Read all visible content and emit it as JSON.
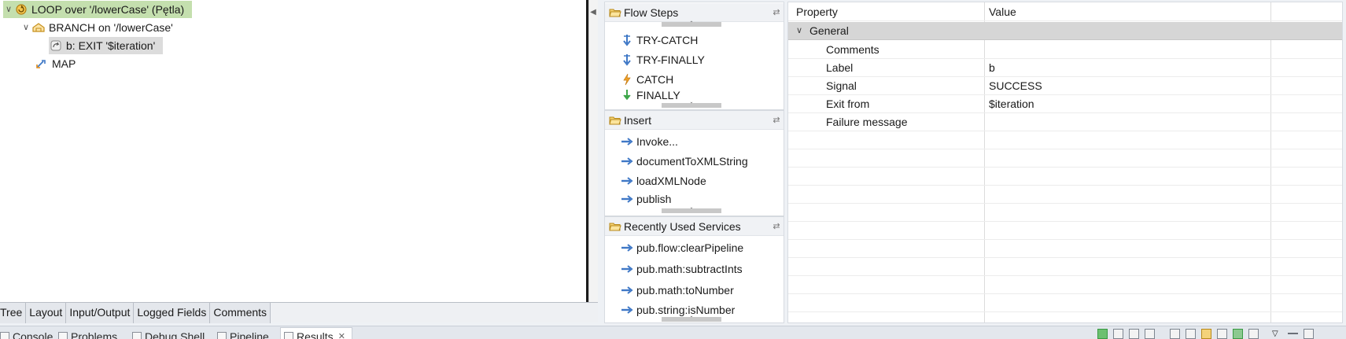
{
  "tree": {
    "nodes": [
      {
        "label": "LOOP over '/lowerCase' (Pętla)",
        "expanded": true,
        "icon": "loop-icon"
      },
      {
        "label": "BRANCH on '/lowerCase'",
        "expanded": true,
        "icon": "branch-icon"
      },
      {
        "label": "b: EXIT '$iteration'",
        "icon": "exit-icon"
      },
      {
        "label": "MAP",
        "icon": "map-icon"
      }
    ],
    "tabs": [
      "Tree",
      "Layout",
      "Input/Output",
      "Logged Fields",
      "Comments"
    ]
  },
  "palette": {
    "sections": [
      {
        "title": "Flow Steps",
        "items": [
          "TRY-CATCH",
          "TRY-FINALLY",
          "CATCH",
          "FINALLY"
        ]
      },
      {
        "title": "Insert",
        "items": [
          "Invoke...",
          "documentToXMLString",
          "loadXMLNode",
          "publish"
        ]
      },
      {
        "title": "Recently Used Services",
        "items": [
          "pub.flow:clearPipeline",
          "pub.math:subtractInts",
          "pub.math:toNumber",
          "pub.string:isNumber"
        ]
      }
    ]
  },
  "properties": {
    "header": {
      "property": "Property",
      "value": "Value"
    },
    "group": "General",
    "rows": [
      {
        "key": "Comments",
        "value": ""
      },
      {
        "key": "Label",
        "value": "b"
      },
      {
        "key": "Signal",
        "value": "SUCCESS"
      },
      {
        "key": "Exit from",
        "value": "$iteration"
      },
      {
        "key": "Failure message",
        "value": ""
      }
    ]
  },
  "console": {
    "tabs": [
      "Console",
      "Problems",
      "Debug Shell",
      "Pipeline",
      "Results"
    ],
    "active_tab": "Results"
  },
  "colors": {
    "tree_selection": "#c4dfae",
    "row_selection": "#dcdcdc",
    "group_row": "#d6d6d6",
    "arrow_icon": "#3f78c6"
  }
}
